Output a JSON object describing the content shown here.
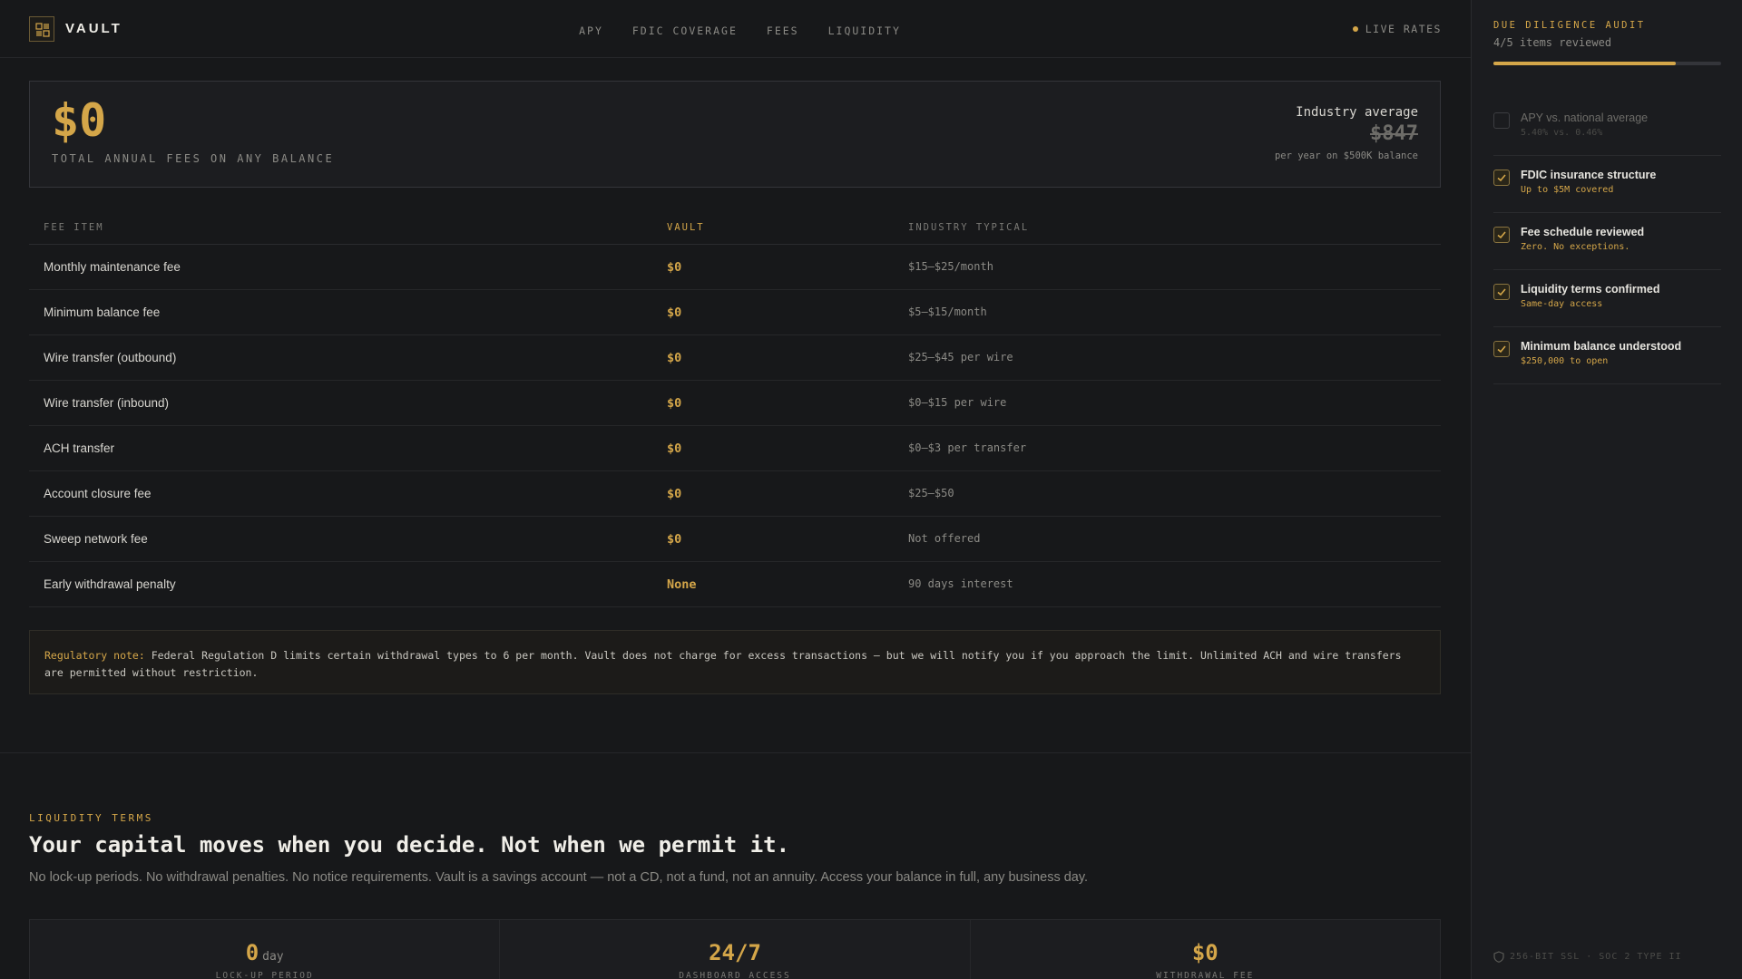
{
  "brand": {
    "name": "VAULT"
  },
  "nav": {
    "items": [
      "APY",
      "FDIC COVERAGE",
      "FEES",
      "LIQUIDITY"
    ]
  },
  "live": {
    "label": "LIVE RATES"
  },
  "hero": {
    "amount": "$0",
    "caption": "TOTAL ANNUAL FEES ON ANY BALANCE",
    "industry_label": "Industry average",
    "industry_value": "$847",
    "industry_sub": "per year on $500K balance"
  },
  "fee_table": {
    "headers": [
      "FEE ITEM",
      "VAULT",
      "INDUSTRY TYPICAL"
    ],
    "rows": [
      {
        "item": "Monthly maintenance fee",
        "vault": "$0",
        "industry": "$15–$25/month"
      },
      {
        "item": "Minimum balance fee",
        "vault": "$0",
        "industry": "$5–$15/month"
      },
      {
        "item": "Wire transfer (outbound)",
        "vault": "$0",
        "industry": "$25–$45 per wire"
      },
      {
        "item": "Wire transfer (inbound)",
        "vault": "$0",
        "industry": "$0–$15 per wire"
      },
      {
        "item": "ACH transfer",
        "vault": "$0",
        "industry": "$0–$3 per transfer"
      },
      {
        "item": "Account closure fee",
        "vault": "$0",
        "industry": "$25–$50"
      },
      {
        "item": "Sweep network fee",
        "vault": "$0",
        "industry": "Not offered"
      },
      {
        "item": "Early withdrawal penalty",
        "vault": "None",
        "industry": "90 days interest"
      }
    ]
  },
  "reg_note": {
    "label": "Regulatory note:",
    "text": "Federal Regulation D limits certain withdrawal types to 6 per month. Vault does not charge for excess transactions — but we will notify you if you approach the limit. Unlimited ACH and wire transfers are permitted without restriction."
  },
  "liquidity": {
    "eyebrow": "LIQUIDITY TERMS",
    "title": "Your capital moves when you decide. Not when we permit it.",
    "desc": "No lock-up periods. No withdrawal penalties. No notice requirements. Vault is a savings account — not a CD, not a fund, not an annuity. Access your balance in full, any business day.",
    "stats": [
      {
        "value": "0",
        "unit": "day",
        "label": "LOCK-UP PERIOD"
      },
      {
        "value": "24/7",
        "unit": "",
        "label": "DASHBOARD ACCESS"
      },
      {
        "value": "$0",
        "unit": "",
        "label": "WITHDRAWAL FEE"
      }
    ]
  },
  "audit": {
    "eyebrow": "DUE DILIGENCE AUDIT",
    "count": "4/5 items reviewed",
    "progress": 0.8,
    "items": [
      {
        "title": "APY vs. national average",
        "sub": "5.40% vs. 0.46%",
        "checked": false
      },
      {
        "title": "FDIC insurance structure",
        "sub": "Up to $5M covered",
        "checked": true
      },
      {
        "title": "Fee schedule reviewed",
        "sub": "Zero. No exceptions.",
        "checked": true
      },
      {
        "title": "Liquidity terms confirmed",
        "sub": "Same-day access",
        "checked": true
      },
      {
        "title": "Minimum balance understood",
        "sub": "$250,000 to open",
        "checked": true
      }
    ],
    "footer": "256-BIT SSL · SOC 2 TYPE II"
  },
  "colors": {
    "accent": "#d4a649",
    "background": "#17181a",
    "sidebar": "#1b1c1f"
  }
}
